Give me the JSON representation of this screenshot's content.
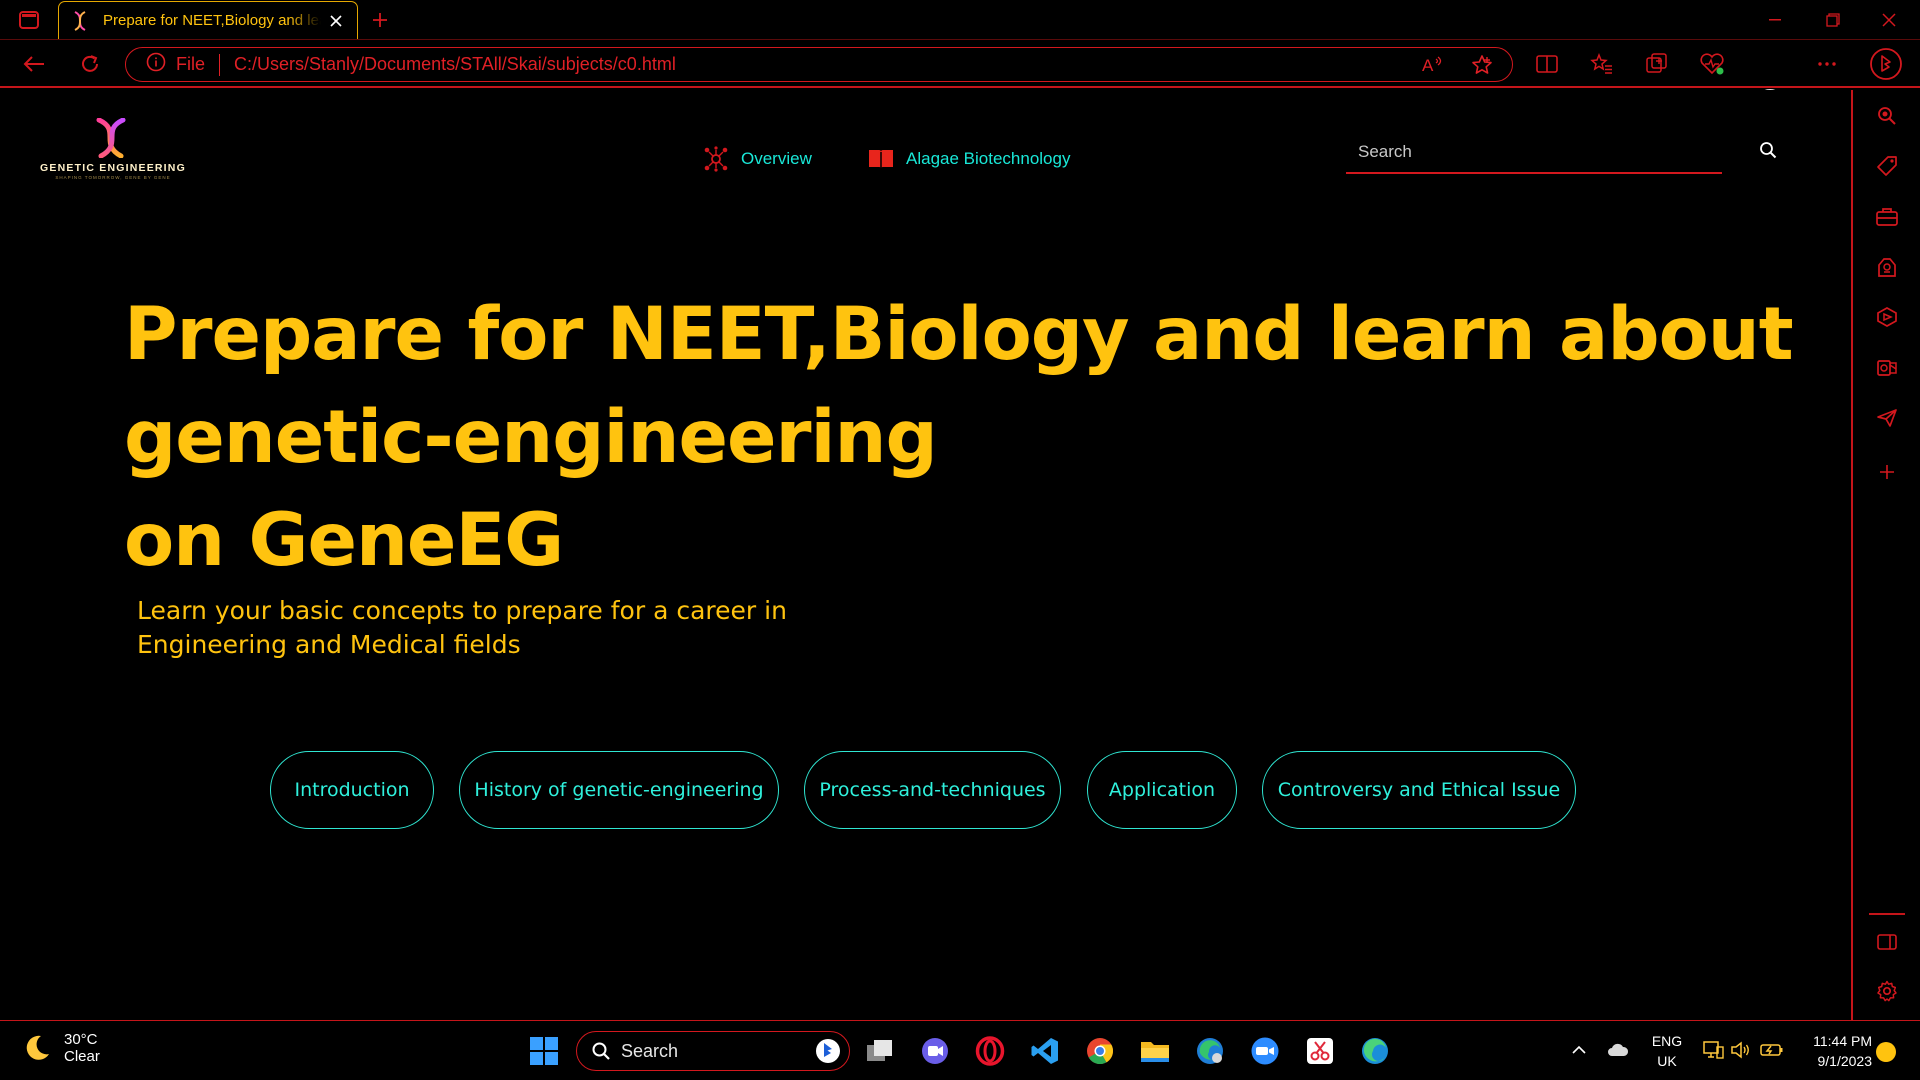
{
  "browser": {
    "tab_title": "Prepare for NEET,Biology and learn about genetic-engineering",
    "address_scheme": "File",
    "address_url": "C:/Users/Stanly/Documents/STAll/Skai/subjects/c0.html"
  },
  "site": {
    "logo": {
      "name": "GENETIC ENGINEERING",
      "tagline": "SHAPING TOMORROW, GENE BY GENE"
    },
    "nav": {
      "overview": "Overview",
      "alagae": "Alagae Biotechnology"
    },
    "search": {
      "placeholder": "Search"
    },
    "hero": {
      "line1": "Prepare for NEET,Biology and learn about",
      "line2": "genetic-engineering",
      "line3": "on GeneEG"
    },
    "subtitle": {
      "line1": "Learn your basic concepts to prepare for a career in",
      "line2": "Engineering and Medical fields"
    },
    "topics": [
      "Introduction",
      "History of genetic-engineering",
      "Process-and-techniques",
      "Application",
      "Controversy and Ethical Issue"
    ]
  },
  "taskbar": {
    "weather_temp": "30°C",
    "weather_condition": "Clear",
    "search_label": "Search",
    "lang_top": "ENG",
    "lang_bottom": "UK",
    "time": "11:44 PM",
    "date": "9/1/2023"
  },
  "colors": {
    "accent_red": "#d3181e",
    "hero_yellow": "#ffc30f",
    "cyan": "#2ff0dc",
    "background": "#000000"
  }
}
